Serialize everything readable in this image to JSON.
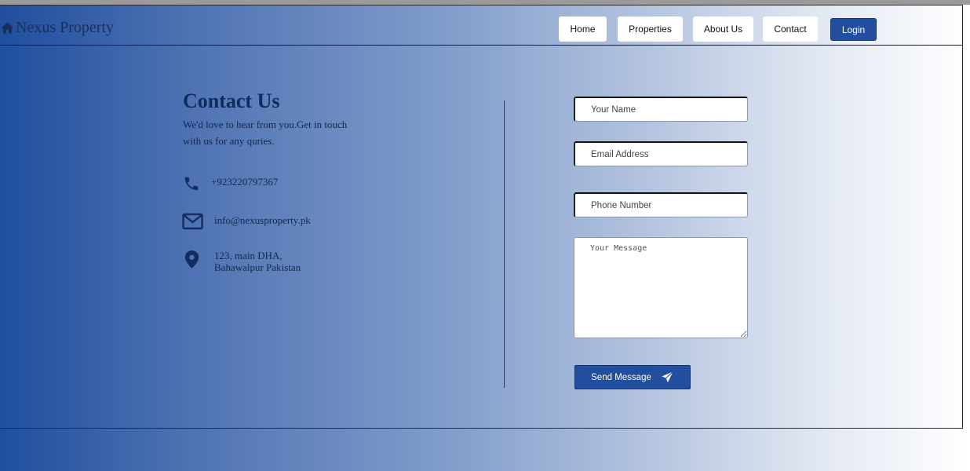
{
  "brand": {
    "name": "Nexus Property",
    "icon": "house-icon"
  },
  "nav": {
    "items": [
      {
        "label": "Home"
      },
      {
        "label": "Properties"
      },
      {
        "label": "About Us"
      },
      {
        "label": "Contact"
      }
    ],
    "login_label": "Login"
  },
  "contact": {
    "title": "Contact Us",
    "subtitle": "We'd love to hear from you.Get in touch with us for any quries.",
    "phone": "+923220797367",
    "email": "info@nexusproperty.pk",
    "address_line1": "123, main DHA,",
    "address_line2": "Bahawalpur Pakistan"
  },
  "form": {
    "name_placeholder": "Your Name",
    "email_placeholder": "Email Address",
    "phone_placeholder": "Phone Number",
    "message_placeholder": "Your Message",
    "send_label": "Send Message",
    "send_icon": "paper-plane-icon"
  },
  "colors": {
    "accent": "#214e9e",
    "text_dark": "#0f2a5c",
    "gradient_start": "#1f4f9e",
    "gradient_end": "#ffffff"
  }
}
